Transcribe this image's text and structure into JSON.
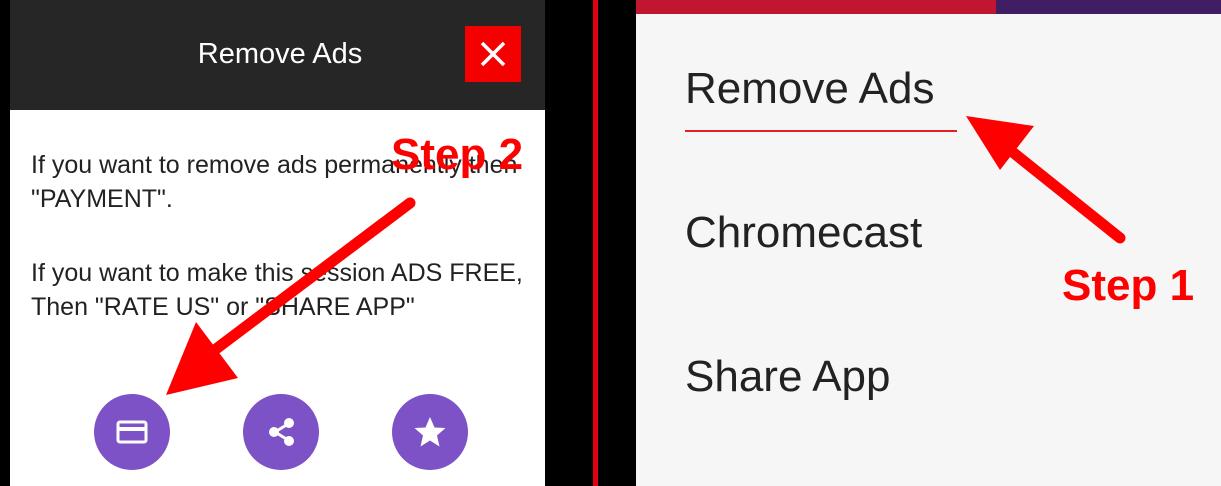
{
  "left_dialog": {
    "title": "Remove Ads",
    "paragraph1": "If you want to remove ads permanently then \"PAYMENT\".",
    "paragraph2": "If you want to make this session ADS FREE, Then \"RATE US\" or \"SHARE APP\"",
    "buttons": [
      {
        "icon": "credit-card-icon"
      },
      {
        "icon": "share-icon"
      },
      {
        "icon": "star-icon"
      }
    ],
    "close_icon": "close-icon"
  },
  "right_menu": {
    "items": [
      {
        "label": "Remove Ads"
      },
      {
        "label": "Chromecast"
      },
      {
        "label": "Share App"
      }
    ]
  },
  "annotations": {
    "step2": "Step 2",
    "step1": "Step 1"
  },
  "colors": {
    "accent_purple": "#7c52c6",
    "close_red": "#f40000",
    "annotation_red": "#ff0000",
    "dialog_header": "#262626",
    "menu_underline": "#e12027"
  }
}
